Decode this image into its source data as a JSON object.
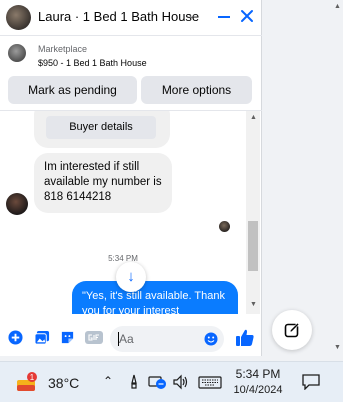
{
  "chat": {
    "contact_name": "Laura",
    "title": "Laura · 1 Bed 1 Bath House"
  },
  "listing": {
    "source": "Marketplace",
    "item": "$950 - 1 Bed 1 Bath House"
  },
  "actions": {
    "pending_label": "Mark as pending",
    "options_label": "More options"
  },
  "messages": {
    "buyer_details_label": "Buyer details",
    "incoming_text": "Im interested if still available my number is 818 6144218",
    "timestamp": "5:34 PM",
    "outgoing_text": "\"Yes, it's still available. Thank you for your interest"
  },
  "composer": {
    "placeholder": "Aa"
  },
  "taskbar": {
    "temperature": "38°C",
    "time": "5:34 PM",
    "date": "10/4/2024",
    "weather_badge": "1"
  },
  "colors": {
    "accent": "#0866ff",
    "outgoing_bubble": "#0a7cff",
    "incoming_bubble": "#f0f0f0"
  },
  "icons": [
    "chevron-down-icon",
    "minimize-icon",
    "close-icon",
    "plus-circle-icon",
    "photo-icon",
    "sticker-icon",
    "gif-icon",
    "emoji-icon",
    "thumbs-up-icon",
    "compose-icon",
    "weather-icon",
    "wifi-icon",
    "volume-icon",
    "keyboard-icon",
    "notification-icon"
  ]
}
